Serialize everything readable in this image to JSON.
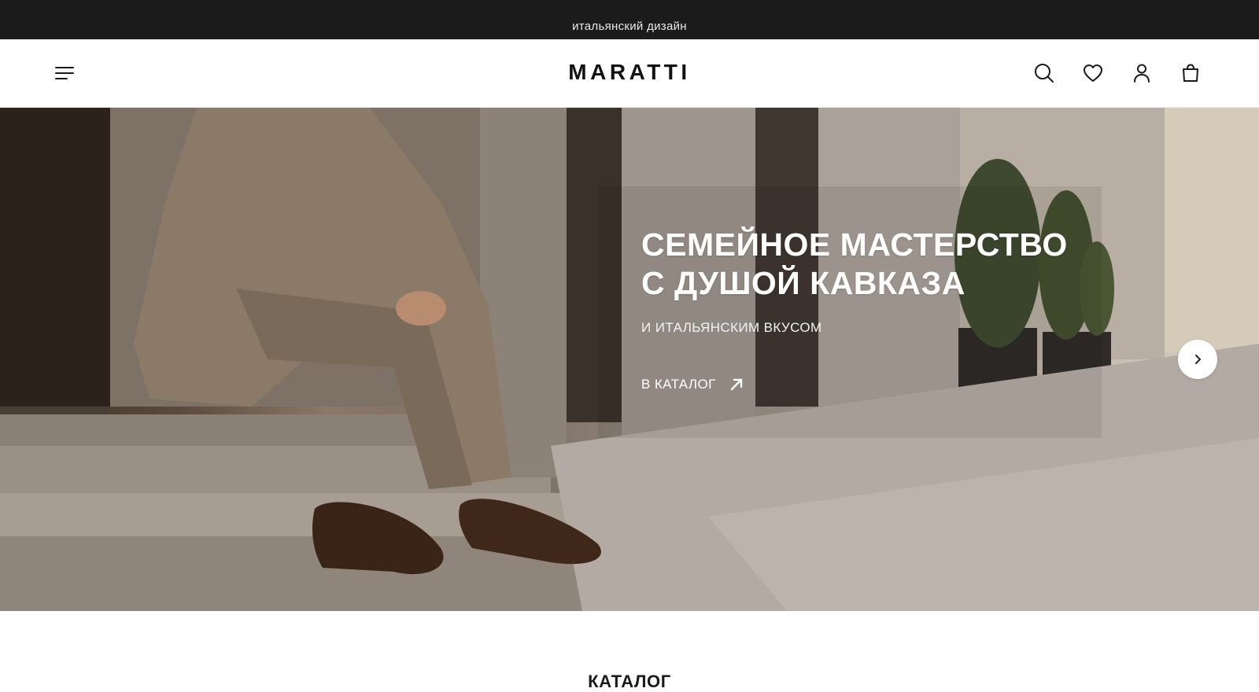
{
  "topbar": {
    "text": "итальянский дизайн"
  },
  "header": {
    "logo": "MARATTI",
    "icons": [
      "menu-icon",
      "search-icon",
      "heart-icon",
      "user-icon",
      "bag-icon"
    ]
  },
  "hero": {
    "title_line1": "СЕМЕЙНОЕ МАСТЕРСТВО",
    "title_line2": "С ДУШОЙ КАВКАЗА",
    "subtitle": "И ИТАЛЬЯНСКИМ ВКУСОМ",
    "cta_label": "В КАТАЛОГ"
  },
  "catalog": {
    "title": "КАТАЛОГ"
  },
  "colors": {
    "topbar_bg": "#1b1b1b",
    "text_dark": "#1a1a1a",
    "hero_text": "#ffffff"
  }
}
